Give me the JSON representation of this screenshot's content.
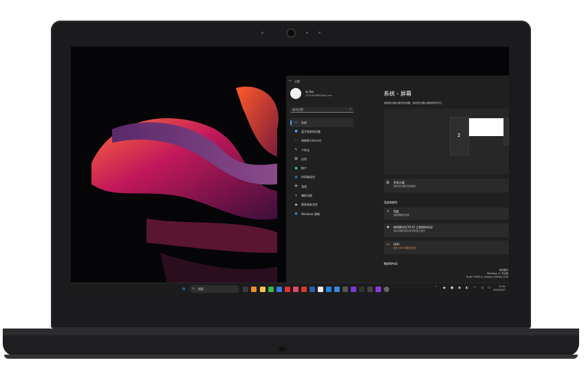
{
  "settings": {
    "window_title": "设置",
    "back": "←",
    "user": {
      "name": "zy fan",
      "email": "1402400865@qq.com"
    },
    "search_placeholder": "查找设置",
    "nav": [
      {
        "label": "系统",
        "icon": "monitor-icon",
        "glyph": "▭",
        "color": "#4aa8ff"
      },
      {
        "label": "蓝牙和其他设备",
        "icon": "bluetooth-icon",
        "glyph": "●",
        "color": "#4aa8ff"
      },
      {
        "label": "网络和 Internet",
        "icon": "wifi-icon",
        "glyph": "◠",
        "color": "#4aa8ff"
      },
      {
        "label": "个性化",
        "icon": "brush-icon",
        "glyph": "✎",
        "color": "#f2b35a"
      },
      {
        "label": "应用",
        "icon": "apps-icon",
        "glyph": "▦",
        "color": "#9ab8d8"
      },
      {
        "label": "帐户",
        "icon": "account-icon",
        "glyph": "●",
        "color": "#34c28a"
      },
      {
        "label": "时间和语言",
        "icon": "globe-icon",
        "glyph": "◍",
        "color": "#4aa8ff"
      },
      {
        "label": "游戏",
        "icon": "gamepad-icon",
        "glyph": "◓",
        "color": "#bbbbbb"
      },
      {
        "label": "辅助功能",
        "icon": "accessibility-icon",
        "glyph": "✦",
        "color": "#4aa8ff"
      },
      {
        "label": "隐私和安全性",
        "icon": "shield-icon",
        "glyph": "◆",
        "color": "#bbbbbb"
      },
      {
        "label": "Windows 更新",
        "icon": "update-icon",
        "glyph": "◉",
        "color": "#4aa8ff"
      }
    ],
    "breadcrumb": {
      "parent": "系统",
      "separator": "›",
      "current": "屏幕"
    },
    "description": "选择显示器以更改其设置。拖动显示器以重新排列它们。",
    "display_label": "2",
    "multi_display": {
      "title": "多显示器",
      "subtitle": "选择显示器的呈现模式"
    },
    "section_brightness": "亮度和颜色",
    "brightness": {
      "title": "亮度",
      "subtitle": "调整屏幕的亮度"
    },
    "night_light": {
      "title": "夜间模式在19:43 之前保持关闭",
      "subtitle": "使用较暖的颜色来帮助阻止蓝光"
    },
    "hdr": {
      "title": "HDR",
      "subtitle": "有关 HDR 的更多信息"
    },
    "section_scale": "缩放和布局"
  },
  "taskbar": {
    "search_label": "搜索",
    "clock_time": "17:01",
    "clock_date": "2023/7/27",
    "watermark_line1": "测试模式",
    "watermark_line2": "Windows 11 专业版",
    "watermark_line3": "Build 23493.ni_release.220506-1250"
  }
}
